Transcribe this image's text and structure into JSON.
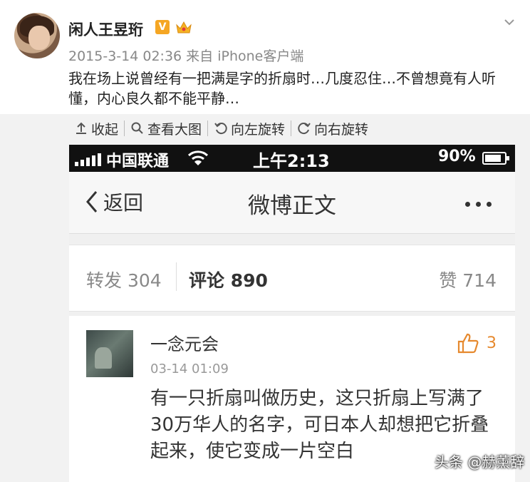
{
  "post": {
    "username": "闲人王昱珩",
    "v_badge": "V",
    "meta": "2015-3-14 02:36 来自 iPhone客户端",
    "text": "我在场上说曾经有一把满是字的折扇时…几度忍住…不曾想竟有人听懂，内心良久都不能平静…"
  },
  "toolbar": {
    "collapse": "收起",
    "view_large": "查看大图",
    "rotate_left": "向左旋转",
    "rotate_right": "向右旋转"
  },
  "phone": {
    "status": {
      "carrier": "中国联通",
      "time": "上午2:13",
      "battery": "90%"
    },
    "nav": {
      "back": "返回",
      "title": "微博正文"
    },
    "stats": {
      "repost": "转发 304",
      "comment_label": "评论",
      "comment_count": "890",
      "like": "赞 714"
    },
    "comment": {
      "name": "一念元会",
      "time": "03-14 01:09",
      "likes": "3",
      "text": "有一只折扇叫做历史，这只折扇上写满了30万华人的名字，可日本人却想把它折叠起来，使它变成一片空白"
    }
  },
  "watermark": "头条 @赫薰辞",
  "colors": {
    "accent_orange": "#e6892e",
    "status_bar": "#111111"
  }
}
